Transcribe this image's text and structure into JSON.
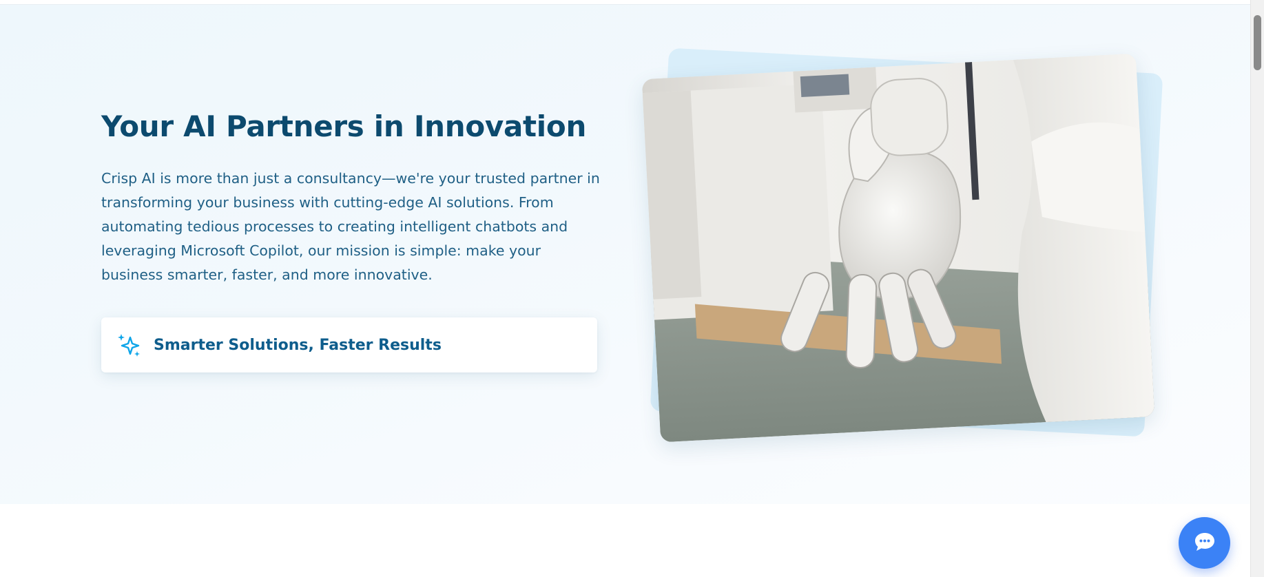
{
  "hero": {
    "headline": "Your AI Partners in Innovation",
    "description": "Crisp AI is more than just a consultancy—we're your trusted partner in transforming your business with cutting-edge AI solutions. From automating tedious processes to creating intelligent chatbots and leveraging Microsoft Copilot, our mission is simple: make your business smarter, faster, and more innovative.",
    "feature_card": {
      "label": "Smarter Solutions, Faster Results",
      "icon": "sparkles-icon"
    },
    "image": {
      "subject": "robot-hand-photo"
    }
  },
  "chat_button": {
    "icon": "chat-bubble-icon"
  },
  "colors": {
    "heading": "#0c4a6e",
    "body_text": "#1f5f85",
    "accent": "#0ea5e9",
    "chat_button": "#3b82f6",
    "hero_background": "#eef7fc"
  }
}
